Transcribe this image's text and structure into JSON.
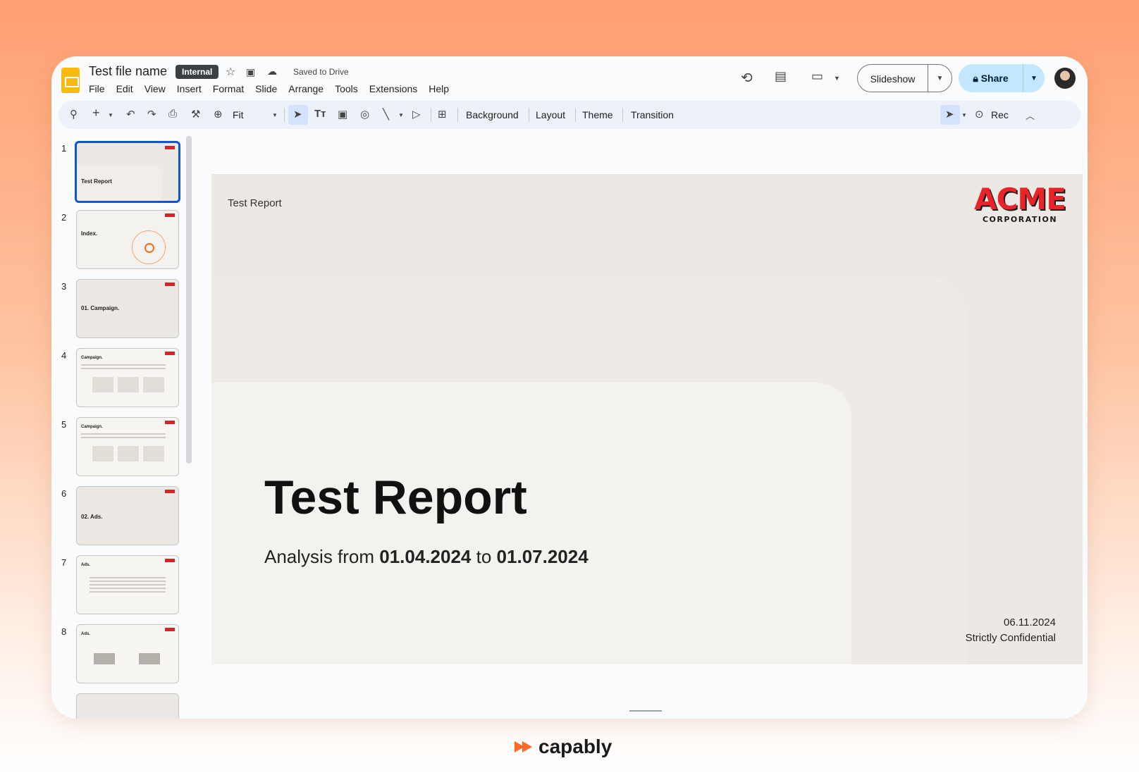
{
  "header": {
    "doc_title": "Test file name",
    "badge": "Internal",
    "saved_status": "Saved to Drive"
  },
  "menu": [
    "File",
    "Edit",
    "View",
    "Insert",
    "Format",
    "Slide",
    "Arrange",
    "Tools",
    "Extensions",
    "Help"
  ],
  "buttons": {
    "slideshow": "Slideshow",
    "share": "Share"
  },
  "toolbar": {
    "zoom": "Fit",
    "background": "Background",
    "layout": "Layout",
    "theme": "Theme",
    "transition": "Transition",
    "rec": "Rec"
  },
  "thumbnails": [
    {
      "num": "1",
      "title": "Test Report"
    },
    {
      "num": "2",
      "title": "Index."
    },
    {
      "num": "3",
      "title": "01. Campaign."
    },
    {
      "num": "4",
      "title": "Campaign."
    },
    {
      "num": "5",
      "title": "Campaign."
    },
    {
      "num": "6",
      "title": "02. Ads."
    },
    {
      "num": "7",
      "title": "Ads."
    },
    {
      "num": "8",
      "title": "Ads."
    }
  ],
  "slide": {
    "header": "Test Report",
    "logo_word": "ACME",
    "logo_sub": "CORPORATION",
    "title": "Test Report",
    "subtitle_prefix": "Analysis from ",
    "date_from": "01.04.2024",
    "subtitle_mid": " to ",
    "date_to": "01.07.2024",
    "date": "06.11.2024",
    "confidential": "Strictly Confidential"
  },
  "brand": "capably",
  "colors": {
    "accent": "#0b57d0",
    "share_bg": "#c2e7ff",
    "logo_red": "#e8232a",
    "brand_orange": "#ff6a2b"
  }
}
